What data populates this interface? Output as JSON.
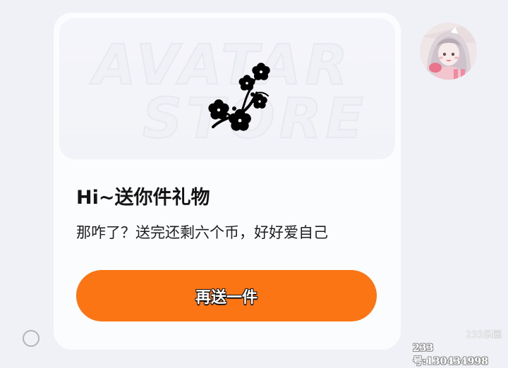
{
  "card": {
    "banner": {
      "watermark_line1": "AVATAR",
      "watermark_line2": "STORE",
      "icon": "plum-blossom-branch-icon"
    },
    "title": "Hi~送你件礼物",
    "description": "那咋了？送完还剩六个币，好好爱自己",
    "button_label": "再送一件"
  },
  "avatar": {
    "icon": "avatar-anime-character"
  },
  "footer": {
    "logo_text": "233乐园",
    "user_id": "233号:130434998"
  },
  "colors": {
    "background": "#eff1f6",
    "card": "#fbfcfe",
    "button": "#fb7514"
  }
}
